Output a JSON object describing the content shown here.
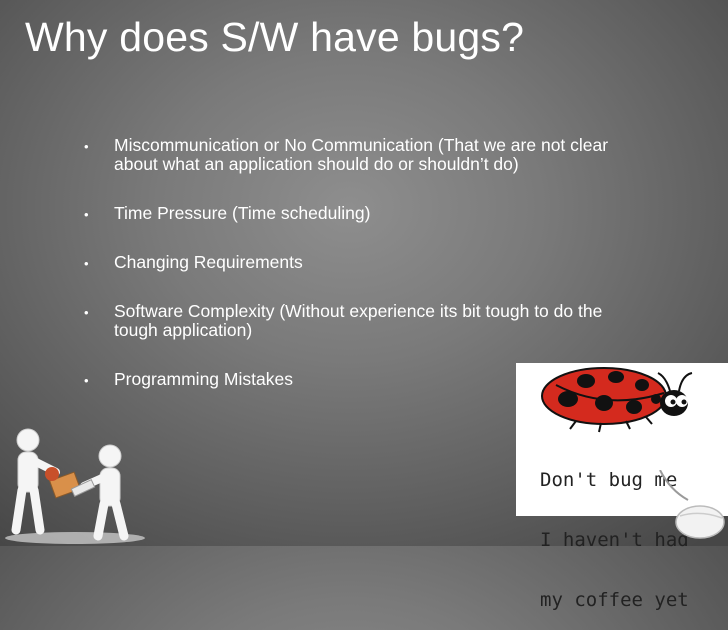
{
  "slide": {
    "title": "Why does S/W have bugs?",
    "bullets": [
      {
        "text": "Miscommunication or No Communication (That we are not clear about what an application should do or shouldn’t do)"
      },
      {
        "text": "Time Pressure  (Time scheduling)"
      },
      {
        "text": "Changing Requirements"
      },
      {
        "text": "Software Complexity (Without experience its bit tough to do the tough application)"
      },
      {
        "text": "Programming Mistakes"
      }
    ],
    "bullet_glyph": "•"
  },
  "image_caption": {
    "line1": "Don't bug me",
    "line2": "I haven't had",
    "line3": "my coffee yet"
  },
  "icons": {
    "ladybug": "ladybug-icon",
    "people": "people-exchanging-package-illustration",
    "mouse": "computer-mouse-icon"
  },
  "colors": {
    "text": "#ffffff",
    "ladybug_red": "#d42a1e",
    "ladybug_black": "#111111"
  }
}
